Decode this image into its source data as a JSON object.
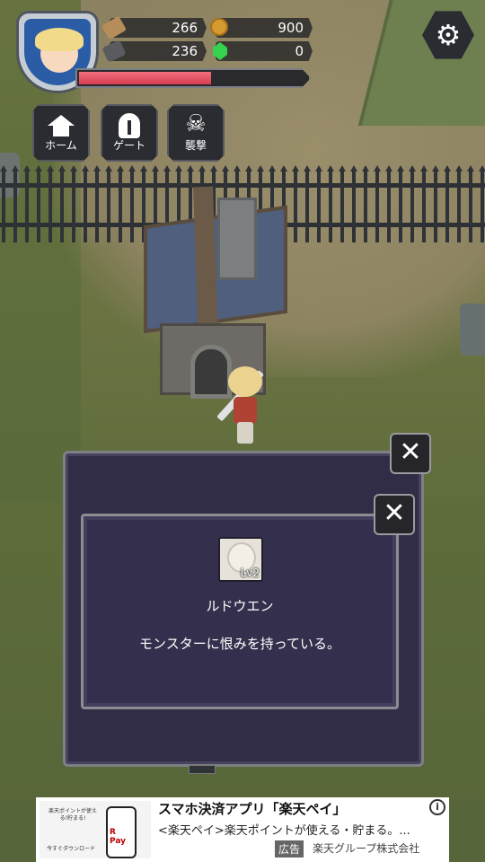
{
  "hud": {
    "wood": "266",
    "ore": "236",
    "gold": "900",
    "gems": "0",
    "hp_fraction": 0.58
  },
  "nav": {
    "home_label": "ホーム",
    "gate_label": "ゲート",
    "raid_label": "襲撃"
  },
  "dialog": {
    "npc_name": "ルドウエン",
    "npc_level": "Lv2",
    "npc_description": "モンスターに恨みを持っている。",
    "close_symbol": "✕"
  },
  "ad": {
    "thumb_top_text": "楽天ポイントが使える!貯まる!",
    "thumb_logo": "R Pay",
    "thumb_small": "今すぐダウンロード",
    "title": "スマホ決済アプリ「楽天ペイ」",
    "text": "<楽天ペイ>楽天ポイントが使える・貯まる。...",
    "badge": "広告",
    "advertiser": "楽天グループ株式会社",
    "info_symbol": "i"
  },
  "colors": {
    "panel": "#312d47",
    "hp": "#d73c4f",
    "gem": "#36d14f",
    "coin": "#d59a2f"
  },
  "icons": [
    "gear-icon",
    "home-icon",
    "helmet-icon",
    "skull-icon",
    "wood-icon",
    "ore-icon",
    "coin-icon",
    "gem-icon",
    "close-icon",
    "info-icon"
  ]
}
